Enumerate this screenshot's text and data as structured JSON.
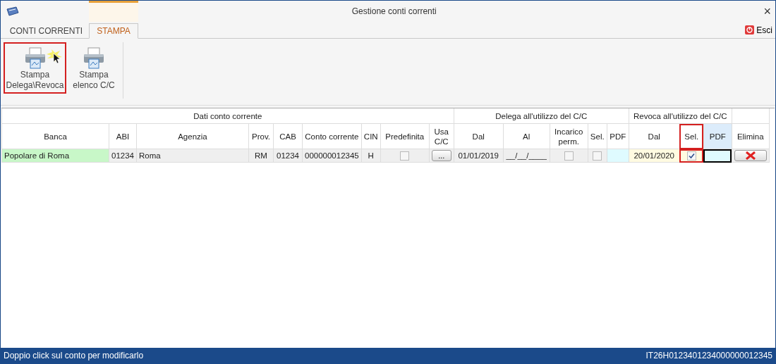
{
  "window": {
    "title": "Gestione conti correnti",
    "close": "×"
  },
  "tabs": [
    {
      "label": "CONTI CORRENTI",
      "selected": false
    },
    {
      "label": "STAMPA",
      "selected": true
    }
  ],
  "exit_button": {
    "label": "Esci"
  },
  "ribbon": {
    "buttons": [
      {
        "lines": [
          "Stampa",
          "Delega\\Revoca"
        ],
        "highlighted": true
      },
      {
        "lines": [
          "Stampa",
          "elenco C/C"
        ],
        "highlighted": false
      }
    ]
  },
  "table": {
    "groups": [
      {
        "label": "Dati conto corrente",
        "kind": "data"
      },
      {
        "label": "Delega all'utilizzo del C/C",
        "kind": "delega"
      },
      {
        "label": "Revoca all'utilizzo del C/C",
        "kind": "revoca"
      },
      {
        "kind": "actions"
      }
    ],
    "columns": [
      {
        "label": "Banca",
        "highlighted": false
      },
      {
        "label": "ABI",
        "highlighted": false
      },
      {
        "label": "Agenzia",
        "highlighted": false
      },
      {
        "label": "Prov.",
        "highlighted": false
      },
      {
        "label": "CAB",
        "highlighted": false
      },
      {
        "label": "Conto corrente",
        "highlighted": false
      },
      {
        "label": "CIN",
        "highlighted": false
      },
      {
        "label": "Predefinita",
        "highlighted": false
      },
      {
        "label": "Usa C/C",
        "highlighted": false
      },
      {
        "label": "Dal",
        "highlighted": false
      },
      {
        "label": "Al",
        "highlighted": false
      },
      {
        "label": "Incarico perm.",
        "highlighted": false
      },
      {
        "label": "Sel.",
        "highlighted": false
      },
      {
        "label": "PDF",
        "highlighted": false
      },
      {
        "label": "Dal",
        "highlighted": false
      },
      {
        "label": "Sel.",
        "highlighted": true
      },
      {
        "label": "PDF",
        "highlighted": false,
        "color": "#dcecfb"
      },
      {
        "label": "Elimina",
        "highlighted": false
      }
    ],
    "rows": [
      {
        "cells": [
          {
            "kind": "name",
            "value": "Popolare di Roma",
            "color": "#c8f7c8"
          },
          {
            "kind": "text",
            "value": "01234"
          },
          {
            "kind": "name",
            "value": "Roma"
          },
          {
            "kind": "text",
            "value": "RM"
          },
          {
            "kind": "text",
            "value": "01234"
          },
          {
            "kind": "text",
            "value": "000000012345"
          },
          {
            "kind": "text",
            "value": "H"
          },
          {
            "kind": "checkbox",
            "checked": false
          },
          {
            "kind": "button",
            "value": "..."
          },
          {
            "kind": "text",
            "value": "01/01/2019"
          },
          {
            "kind": "text",
            "value": "__/__/____"
          },
          {
            "kind": "checkbox",
            "checked": false
          },
          {
            "kind": "checkbox",
            "checked": false
          },
          {
            "kind": "empty",
            "color": "#dffbff"
          },
          {
            "kind": "text",
            "value": "20/01/2020",
            "color": "#fffbe1"
          },
          {
            "kind": "checkbox",
            "checked": true,
            "color": "#fffbe1"
          },
          {
            "kind": "empty",
            "color": "#dffbff",
            "focused": true
          },
          {
            "kind": "delete"
          }
        ]
      }
    ]
  },
  "status_bar": {
    "hint": "Doppio click sul conto per modificarlo",
    "iban": "IT26H0123401234000000012345"
  }
}
